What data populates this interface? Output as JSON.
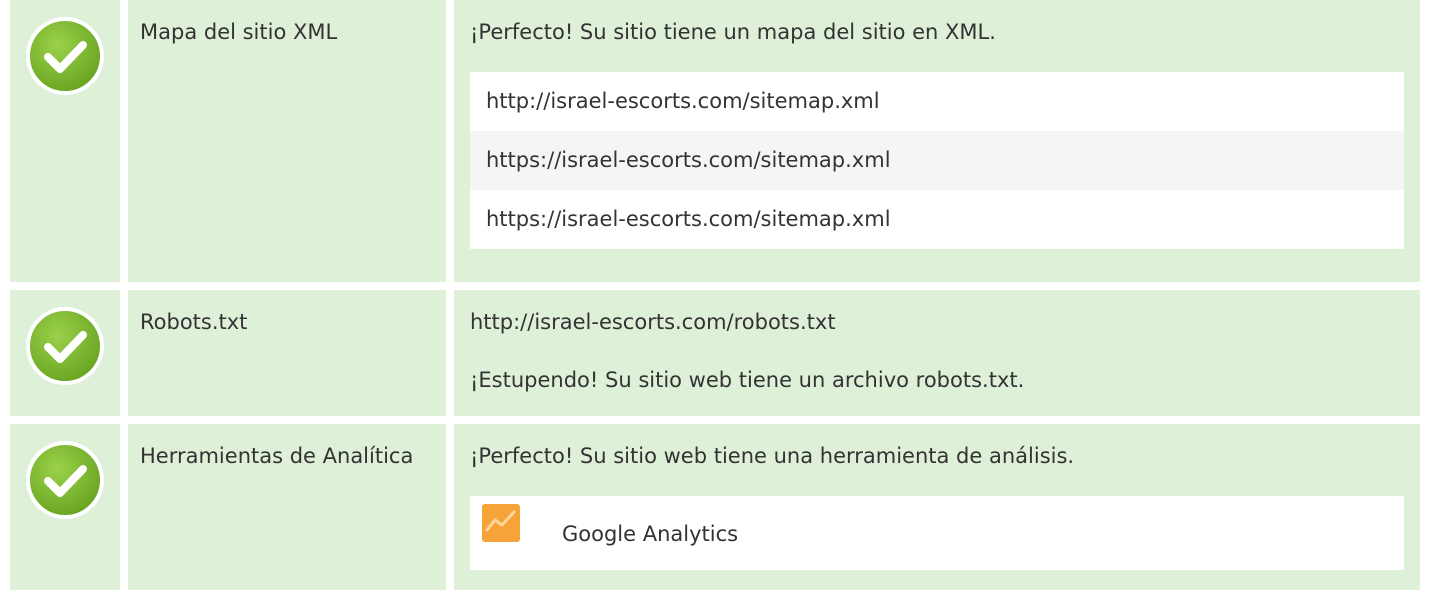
{
  "colors": {
    "row_background": "#dff0d8",
    "check_green": "#7cb82f",
    "list_background": "#ffffff",
    "list_alt_background": "#f5f5f5",
    "ga_orange": "#f6a33a"
  },
  "rows": [
    {
      "status_icon": "check-circle-icon",
      "label": "Mapa del sitio XML",
      "message": "¡Perfecto! Su sitio tiene un mapa del sitio en XML.",
      "sitemaps": [
        "http://israel-escorts.com/sitemap.xml",
        "https://israel-escorts.com/sitemap.xml",
        "https://israel-escorts.com/sitemap.xml"
      ]
    },
    {
      "status_icon": "check-circle-icon",
      "label": "Robots.txt",
      "url": "http://israel-escorts.com/robots.txt",
      "message": "¡Estupendo! Su sitio web tiene un archivo robots.txt."
    },
    {
      "status_icon": "check-circle-icon",
      "label": "Herramientas de Analítica",
      "message": "¡Perfecto! Su sitio web tiene una herramienta de análisis.",
      "tool_icon": "google-analytics-icon",
      "tool_name": "Google Analytics"
    }
  ]
}
